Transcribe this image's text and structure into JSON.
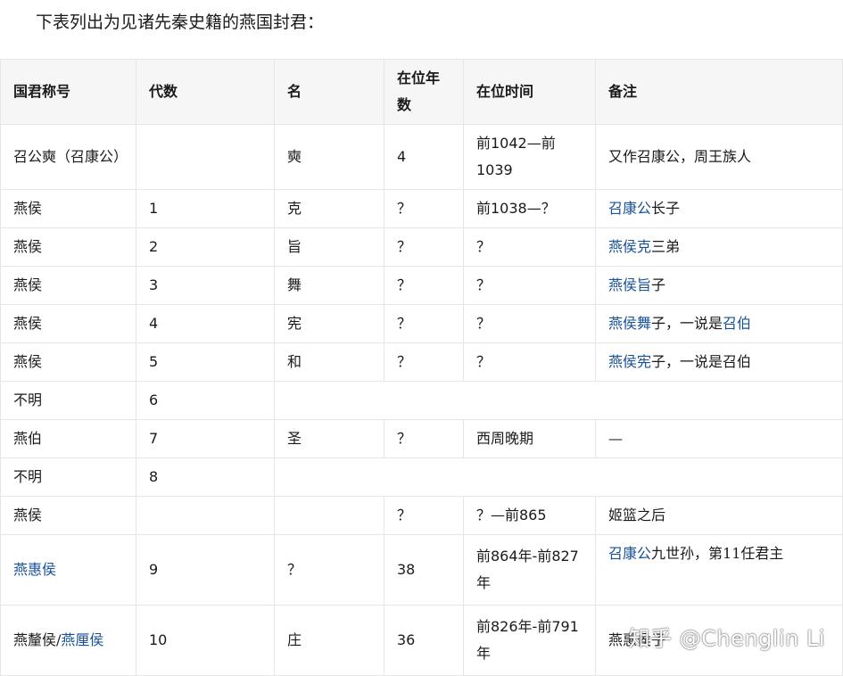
{
  "intro": "下表列出为见诸先秦史籍的燕国封君：",
  "headers": [
    "国君称号",
    "代数",
    "名",
    "在位年数",
    "在位时间",
    "备注"
  ],
  "rows": [
    {
      "title": "召公奭（召康公）",
      "gen": "",
      "name": "奭",
      "years": "4",
      "time": "前1042—前1039",
      "note_link": "",
      "note_text": "又作召康公，周王族人",
      "note_link2": "",
      "note_text2": ""
    },
    {
      "title": "燕侯",
      "gen": "1",
      "name": "克",
      "years": "？",
      "time": "前1038—？",
      "note_link": "召康公",
      "note_text": "长子",
      "note_link2": "",
      "note_text2": ""
    },
    {
      "title": "燕侯",
      "gen": "2",
      "name": "旨",
      "years": "？",
      "time": "？",
      "note_link": "燕侯克",
      "note_text": "三弟",
      "note_link2": "",
      "note_text2": ""
    },
    {
      "title": "燕侯",
      "gen": "3",
      "name": "舞",
      "years": "？",
      "time": "？",
      "note_link": "燕侯旨",
      "note_text": "子",
      "note_link2": "",
      "note_text2": ""
    },
    {
      "title": "燕侯",
      "gen": "4",
      "name": "宪",
      "years": "？",
      "time": "？",
      "note_link": "燕侯舞",
      "note_text": "子，一说是",
      "note_link2": "召伯",
      "note_text2": ""
    },
    {
      "title": "燕侯",
      "gen": "5",
      "name": "和",
      "years": "？",
      "time": "？",
      "note_link": "燕侯宪",
      "note_text": "子，一说是召伯",
      "note_link2": "",
      "note_text2": ""
    },
    {
      "title": "不明",
      "gen": "6",
      "merged": true
    },
    {
      "title": "燕伯",
      "gen": "7",
      "name": "圣",
      "years": "？",
      "time": "西周晚期",
      "note_link": "",
      "note_text": "—",
      "note_link2": "",
      "note_text2": ""
    },
    {
      "title": "不明",
      "gen": "8",
      "merged": true
    },
    {
      "title": "燕侯",
      "gen": "",
      "name": "",
      "years": "？",
      "time": "？—前865",
      "note_link": "",
      "note_text": "姬篮之后",
      "note_link2": "",
      "note_text2": ""
    },
    {
      "title_link": "燕惠侯",
      "gen": "9",
      "name": "？",
      "years": "38",
      "time": "前864年-前827年",
      "note_link": "召康公",
      "note_text": "九世孙，第11任君主",
      "note_link2": "",
      "note_text2": ""
    },
    {
      "title": "燕釐侯/",
      "title_link2": "燕厘侯",
      "gen": "10",
      "name": "庄",
      "years": "36",
      "time": "前826年-前791年",
      "note_link": "",
      "note_text": "燕惠侯子",
      "note_link2": "",
      "note_text2": ""
    }
  ],
  "watermark": "知乎 @Chenglin Li"
}
